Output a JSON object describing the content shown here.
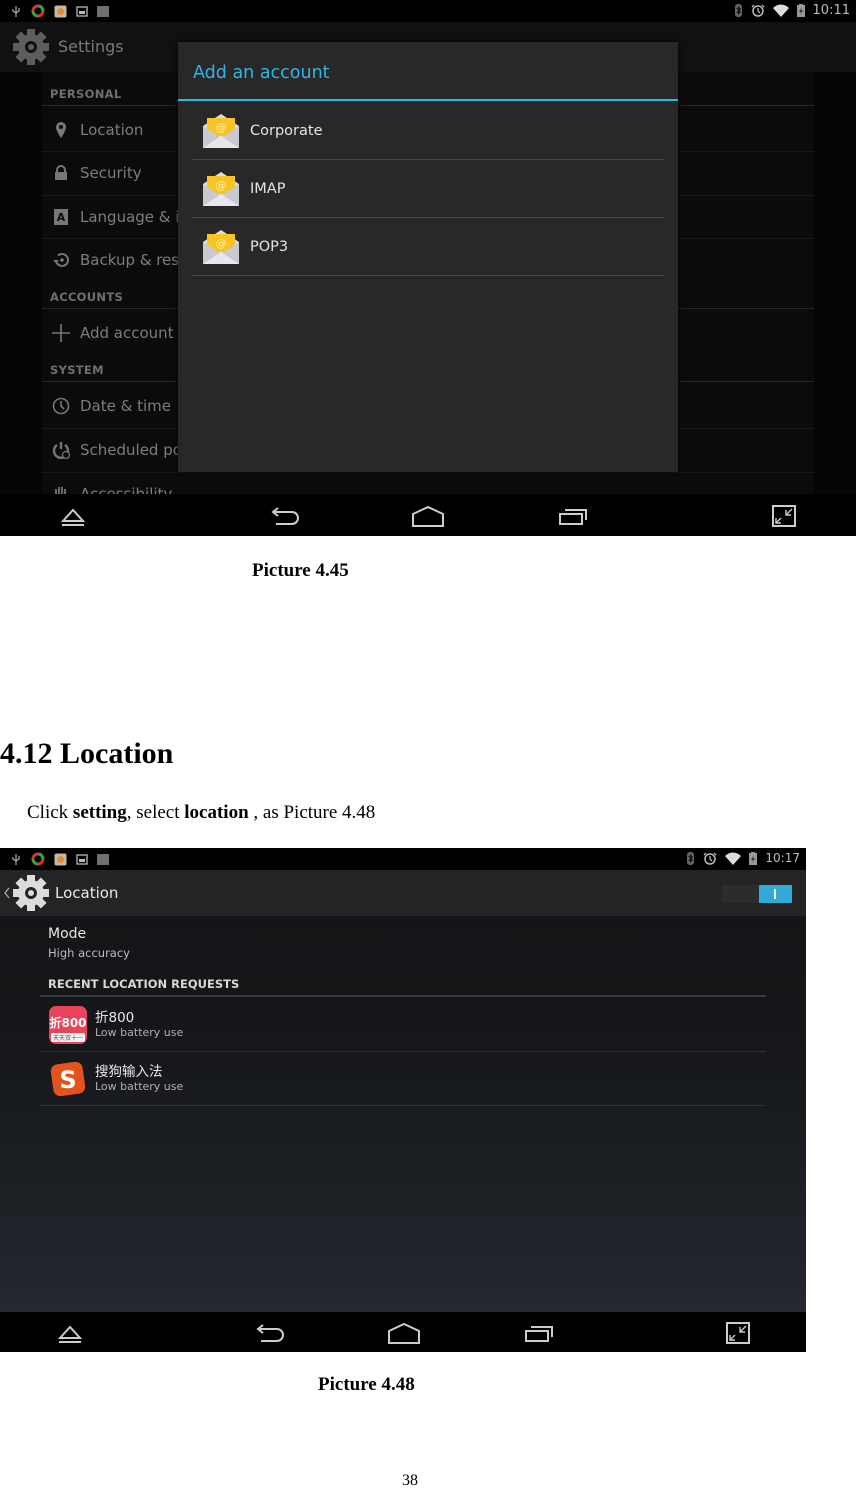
{
  "screenshot1": {
    "status_bar": {
      "left_icons": [
        "usb-icon",
        "app-notification-icon",
        "gallery-notification-icon",
        "screenshot-icon",
        "barcode-icon"
      ],
      "right_icons": [
        "bluetooth-icon",
        "alarm-icon",
        "wifi-icon",
        "battery-charging-icon"
      ],
      "time": "10:11"
    },
    "action_bar": {
      "title": "Settings",
      "icon": "settings-gear-icon"
    },
    "settings_list": {
      "sections": [
        {
          "header": "PERSONAL",
          "items": [
            {
              "label": "Location",
              "icon": "location-pin-icon"
            },
            {
              "label": "Security",
              "icon": "lock-icon"
            },
            {
              "label": "Language & input",
              "icon": "keyboard-a-icon"
            },
            {
              "label": "Backup & reset",
              "icon": "backup-restore-icon"
            }
          ]
        },
        {
          "header": "ACCOUNTS",
          "items": [
            {
              "label": "Add account",
              "icon": "plus-icon"
            }
          ]
        },
        {
          "header": "SYSTEM",
          "items": [
            {
              "label": "Date & time",
              "icon": "clock-icon"
            },
            {
              "label": "Scheduled power on & off",
              "icon": "scheduled-power-icon"
            },
            {
              "label": "Accessibility",
              "icon": "hand-icon"
            }
          ]
        }
      ]
    },
    "dialog": {
      "title": "Add an account",
      "items": [
        {
          "label": "Corporate",
          "icon": "email-envelope-icon"
        },
        {
          "label": "IMAP",
          "icon": "email-envelope-icon"
        },
        {
          "label": "POP3",
          "icon": "email-envelope-icon"
        }
      ]
    },
    "nav_bar": [
      "hide-bar-icon",
      "back-icon",
      "home-icon",
      "recent-apps-icon",
      "screenshot-resize-icon"
    ]
  },
  "caption1": "Picture 4.45",
  "section_heading": "4.12 Location",
  "instruction": {
    "prefix": "Click ",
    "bold1": "setting",
    "middle": ", select ",
    "bold2": "location",
    "suffix": " , as Picture 4.48"
  },
  "screenshot2": {
    "status_bar": {
      "left_icons": [
        "usb-icon",
        "app-notification-icon",
        "gallery-notification-icon",
        "screenshot-icon",
        "barcode-icon"
      ],
      "right_icons": [
        "bluetooth-icon",
        "alarm-icon",
        "wifi-icon",
        "battery-charging-icon"
      ],
      "time": "10:17"
    },
    "action_bar": {
      "title": "Location",
      "back_icon": "chevron-left-icon",
      "icon": "settings-gear-icon",
      "toggle_state": "on",
      "toggle_label": "I"
    },
    "mode": {
      "title": "Mode",
      "value": "High accuracy"
    },
    "recent_header": "RECENT LOCATION REQUESTS",
    "apps": [
      {
        "name": "折800",
        "sub": "Low battery use",
        "icon": "zhe800-app-icon",
        "icon_text": "折800",
        "icon_caption": "天天双十一"
      },
      {
        "name": "搜狗输入法",
        "sub": "Low battery use",
        "icon": "sogou-input-app-icon",
        "icon_text": "S"
      }
    ],
    "nav_bar": [
      "hide-bar-icon",
      "back-icon",
      "home-icon",
      "recent-apps-icon",
      "screenshot-resize-icon"
    ]
  },
  "caption2": "Picture 4.48",
  "page_number": "38",
  "colors": {
    "accent": "#33b5e5",
    "toggle_on": "#33a9d6",
    "envelope_yellow": "#f7c325"
  }
}
